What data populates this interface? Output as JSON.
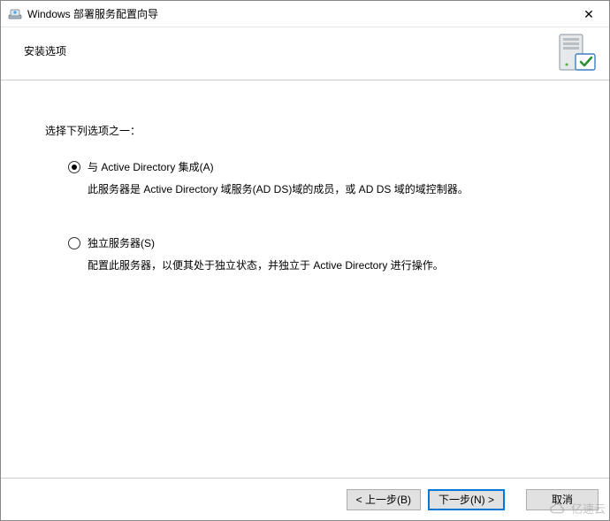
{
  "window": {
    "title": "Windows 部署服务配置向导"
  },
  "header": {
    "page_title": "安装选项"
  },
  "content": {
    "prompt": "选择下列选项之一：",
    "options": [
      {
        "label": "与 Active Directory 集成(A)",
        "description": "此服务器是 Active Directory 域服务(AD DS)域的成员，或 AD DS 域的域控制器。",
        "checked": true
      },
      {
        "label": "独立服务器(S)",
        "description": "配置此服务器，以便其处于独立状态，并独立于 Active Directory 进行操作。",
        "checked": false
      }
    ]
  },
  "buttons": {
    "back": "< 上一步(B)",
    "next": "下一步(N) >",
    "cancel": "取消"
  },
  "watermark": {
    "text": "亿速云"
  }
}
